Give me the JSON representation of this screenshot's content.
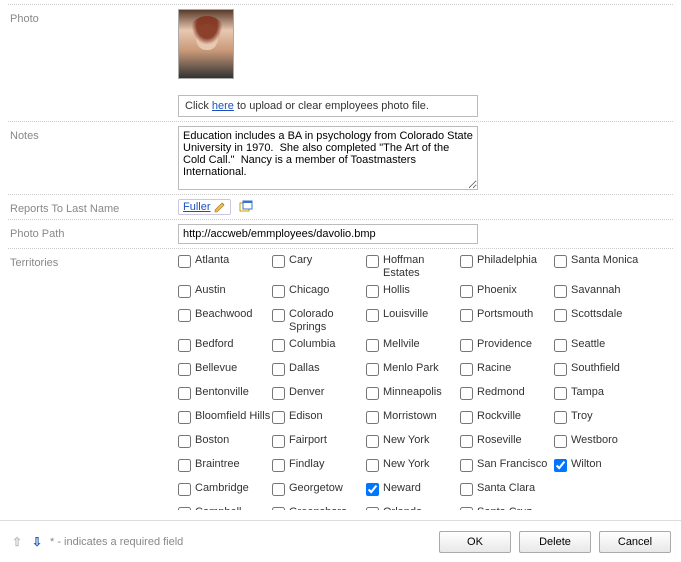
{
  "labels": {
    "photo": "Photo",
    "notes": "Notes",
    "reports_to": "Reports To Last Name",
    "photo_path": "Photo Path",
    "territories": "Territories"
  },
  "photo_hint": {
    "prefix": "Click ",
    "link": "here",
    "suffix": " to upload or clear employees photo file."
  },
  "notes_value": "Education includes a BA in psychology from Colorado State University in 1970.  She also completed \"The Art of the Cold Call.\"  Nancy is a member of Toastmasters International.",
  "reports_to_value": "Fuller",
  "photo_path_value": "http://accweb/emmployees/davolio.bmp",
  "territories": [
    {
      "label": "Atlanta",
      "checked": false
    },
    {
      "label": "Cary",
      "checked": false
    },
    {
      "label": "Hoffman Estates",
      "checked": false
    },
    {
      "label": "Philadelphia",
      "checked": false
    },
    {
      "label": "Santa Monica",
      "checked": false
    },
    {
      "label": "Austin",
      "checked": false
    },
    {
      "label": "Chicago",
      "checked": false
    },
    {
      "label": "Hollis",
      "checked": false
    },
    {
      "label": "Phoenix",
      "checked": false
    },
    {
      "label": "Savannah",
      "checked": false
    },
    {
      "label": "Beachwood",
      "checked": false
    },
    {
      "label": "Colorado Springs",
      "checked": false
    },
    {
      "label": "Louisville",
      "checked": false
    },
    {
      "label": "Portsmouth",
      "checked": false
    },
    {
      "label": "Scottsdale",
      "checked": false
    },
    {
      "label": "Bedford",
      "checked": false
    },
    {
      "label": "Columbia",
      "checked": false
    },
    {
      "label": "Mellvile",
      "checked": false
    },
    {
      "label": "Providence",
      "checked": false
    },
    {
      "label": "Seattle",
      "checked": false
    },
    {
      "label": "Bellevue",
      "checked": false
    },
    {
      "label": "Dallas",
      "checked": false
    },
    {
      "label": "Menlo Park",
      "checked": false
    },
    {
      "label": "Racine",
      "checked": false
    },
    {
      "label": "Southfield",
      "checked": false
    },
    {
      "label": "Bentonville",
      "checked": false
    },
    {
      "label": "Denver",
      "checked": false
    },
    {
      "label": "Minneapolis",
      "checked": false
    },
    {
      "label": "Redmond",
      "checked": false
    },
    {
      "label": "Tampa",
      "checked": false
    },
    {
      "label": "Bloomfield Hills",
      "checked": false
    },
    {
      "label": "Edison",
      "checked": false
    },
    {
      "label": "Morristown",
      "checked": false
    },
    {
      "label": "Rockville",
      "checked": false
    },
    {
      "label": "Troy",
      "checked": false
    },
    {
      "label": "Boston",
      "checked": false
    },
    {
      "label": "Fairport",
      "checked": false
    },
    {
      "label": "New York",
      "checked": false
    },
    {
      "label": "Roseville",
      "checked": false
    },
    {
      "label": "Westboro",
      "checked": false
    },
    {
      "label": "Braintree",
      "checked": false
    },
    {
      "label": "Findlay",
      "checked": false
    },
    {
      "label": "New York",
      "checked": false
    },
    {
      "label": "San Francisco",
      "checked": false
    },
    {
      "label": "Wilton",
      "checked": true
    },
    {
      "label": "Cambridge",
      "checked": false
    },
    {
      "label": "Georgetow",
      "checked": false
    },
    {
      "label": "Neward",
      "checked": true
    },
    {
      "label": "Santa Clara",
      "checked": false
    },
    {
      "label": "",
      "checked": false,
      "empty": true
    },
    {
      "label": "Campbell",
      "checked": false
    },
    {
      "label": "Greensboro",
      "checked": false
    },
    {
      "label": "Orlando",
      "checked": false
    },
    {
      "label": "Santa Cruz",
      "checked": false
    }
  ],
  "footer": {
    "required_note": "* - indicates a required field",
    "ok": "OK",
    "delete": "Delete",
    "cancel": "Cancel"
  }
}
